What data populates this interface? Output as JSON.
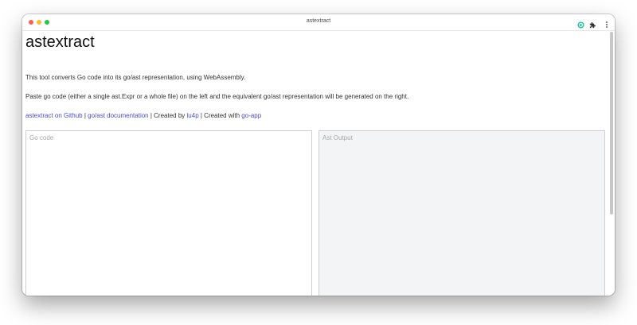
{
  "window": {
    "title": "astextract"
  },
  "page": {
    "title": "astextract",
    "intro": "This tool converts Go code into its go/ast representation, using WebAssembly.",
    "instructions": "Paste go code (either a single ast.Expr or a whole file) on the left and the equivalent go/ast representation will be generated on the right."
  },
  "links": {
    "github": "astextract on Github",
    "sep1": " | ",
    "docs": "go/ast documentation",
    "sep2": " | Created by ",
    "author": "lu4p",
    "sep3": " | Created with ",
    "goapp": "go-app"
  },
  "editor": {
    "input_placeholder": "Go code",
    "output_placeholder": "Ast Output"
  },
  "icons": {
    "ext_a": "grammarly-icon",
    "ext_b": "puzzle-piece-icon",
    "more": "more-vertical-icon"
  },
  "colors": {
    "link": "#4b4bcf",
    "output_bg": "#f3f4f6"
  }
}
